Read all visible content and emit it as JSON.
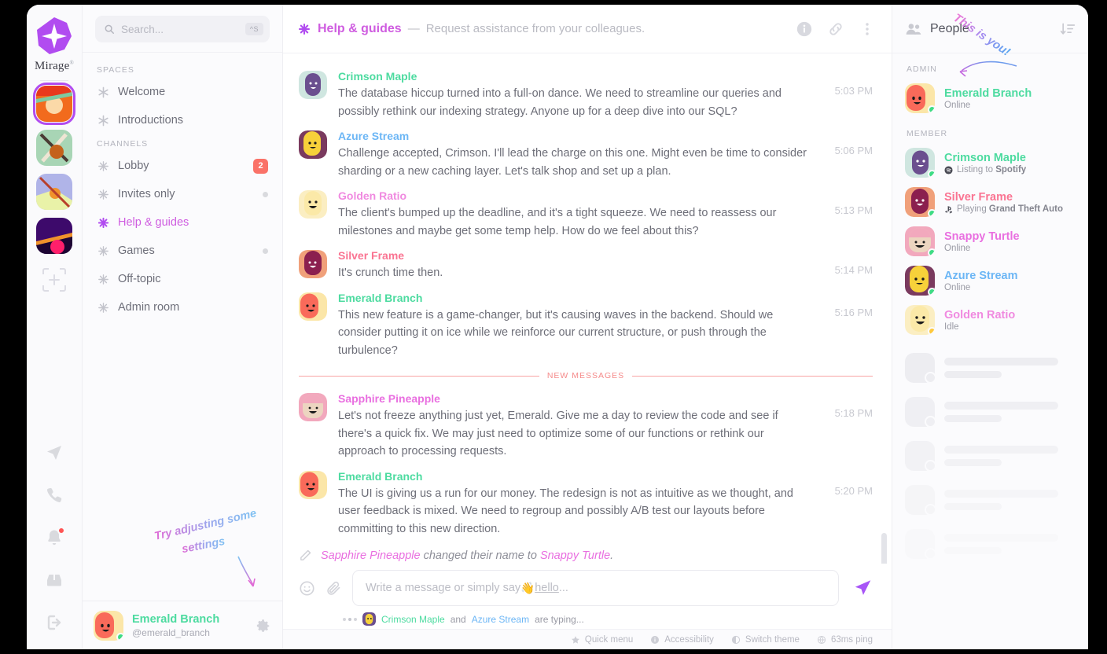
{
  "brand": {
    "name": "Mirage",
    "mark": "sparkle-logo",
    "registered": "®"
  },
  "accent": "#b14cf0",
  "rail": {
    "spaces": [
      {
        "name": "space-sushi",
        "active": true
      },
      {
        "name": "space-noodles",
        "active": false
      },
      {
        "name": "space-landscape",
        "active": false
      },
      {
        "name": "space-night",
        "active": false
      }
    ],
    "add_label": "add-space",
    "bottom_icons": [
      {
        "name": "send-icon",
        "badge": false
      },
      {
        "name": "phone-icon",
        "badge": false
      },
      {
        "name": "bell-icon",
        "badge": true
      },
      {
        "name": "inbox-icon",
        "badge": false
      },
      {
        "name": "logout-icon",
        "badge": false
      }
    ]
  },
  "search": {
    "placeholder": "Search...",
    "shortcut": "^S"
  },
  "sidebar": {
    "spaces_header": "SPACES",
    "spaces": [
      {
        "label": "Welcome",
        "icon": "asterisk-icon"
      },
      {
        "label": "Introductions",
        "icon": "asterisk-icon"
      }
    ],
    "channels_header": "CHANNELS",
    "channels": [
      {
        "label": "Lobby",
        "badge": "2",
        "dot": false,
        "active": false
      },
      {
        "label": "Invites only",
        "badge": null,
        "dot": true,
        "active": false
      },
      {
        "label": "Help & guides",
        "badge": null,
        "dot": false,
        "active": true
      },
      {
        "label": "Games",
        "badge": null,
        "dot": true,
        "active": false
      },
      {
        "label": "Off-topic",
        "badge": null,
        "dot": false,
        "active": false
      },
      {
        "label": "Admin room",
        "badge": null,
        "dot": false,
        "active": false
      }
    ],
    "annotation": {
      "line1": "Try adjusting some",
      "line2": "settings"
    }
  },
  "profile": {
    "name": "Emerald Branch",
    "handle": "@emerald_branch",
    "presence": "online",
    "settings_label": "settings-gear"
  },
  "chat_header": {
    "channel": "Help & guides",
    "dash": "—",
    "description": "Request assistance from your colleagues.",
    "actions": [
      "info-icon",
      "link-icon",
      "more-vertical-icon"
    ]
  },
  "messages": [
    {
      "author": "Crimson Maple",
      "color": "#4ddba0",
      "avatar": "purple-blob",
      "time": "5:03 PM",
      "text": "The database hiccup turned into a full-on dance. We need to streamline our queries and possibly rethink our indexing strategy. Anyone up for a deep dive into our SQL?"
    },
    {
      "author": "Azure Stream",
      "color": "#6cb6f5",
      "avatar": "yellow-blob",
      "time": "5:06 PM",
      "text": "Challenge accepted, Crimson. I'll lead the charge on this one. Might even be time to consider sharding or a new caching layer. Let's talk shop and set up a plan."
    },
    {
      "author": "Golden Ratio",
      "color": "#f08ae0",
      "avatar": "cream-blob",
      "time": "5:13 PM",
      "text": "The client's bumped up the deadline, and it's a tight squeeze. We need to reassess our milestones and maybe get some temp help. How do we feel about this?"
    },
    {
      "author": "Silver Frame",
      "color": "#fa7492",
      "avatar": "maroon-blob",
      "time": "5:14 PM",
      "text": "It's crunch time then."
    },
    {
      "author": "Emerald Branch",
      "color": "#4ddba0",
      "avatar": "red-blob",
      "time": "5:16 PM",
      "text": "This new feature is a game-changer, but it's causing waves in the backend. Should we consider putting it on ice while we reinforce our current structure, or push through the turbulence?"
    }
  ],
  "new_messages_divider": "NEW MESSAGES",
  "messages_after": [
    {
      "author": "Sapphire Pineapple",
      "color": "#e96fe0",
      "avatar": "pink-blob",
      "time": "5:18 PM",
      "text": "Let's not freeze anything just yet, Emerald. Give me a day to review the code and see if there's a quick fix. We may just need to optimize some of our functions or rethink our approach to processing requests."
    },
    {
      "author": "Emerald Branch",
      "color": "#4ddba0",
      "avatar": "red-blob",
      "time": "5:20 PM",
      "text": "The UI is giving us a run for our money. The redesign is not as intuitive as we thought, and user feedback is mixed. We need to regroup and possibly A/B test our layouts before committing to this new direction."
    }
  ],
  "system_message": {
    "icon": "pencil-icon",
    "old_name": "Sapphire Pineapple",
    "middle": " changed their name to ",
    "new_name": "Snappy Turtle",
    "end": "."
  },
  "composer": {
    "emoji_icon": "smiley-icon",
    "attach_icon": "paperclip-icon",
    "placeholder_pre": "Write a message or simply say ",
    "placeholder_emoji": "👋",
    "placeholder_link": "hello",
    "placeholder_post": "...",
    "send_icon": "send-icon",
    "typing_text_mid": " and ",
    "typing_name_1": "Crimson Maple",
    "typing_name_2": "Azure Stream",
    "typing_suffix": " are typing..."
  },
  "statusbar": [
    {
      "icon": "star-icon",
      "label": "Quick menu"
    },
    {
      "icon": "info-icon",
      "label": "Accessibility"
    },
    {
      "icon": "theme-icon",
      "label": "Switch theme"
    },
    {
      "icon": "globe-icon",
      "label": "63ms ping"
    }
  ],
  "people": {
    "title": "People",
    "sort_icon": "sort-descending-icon",
    "annotation": "This is you!",
    "admin_header": "ADMIN",
    "admins": [
      {
        "name": "Emerald Branch",
        "color": "#4ddba0",
        "avatar": "red-blob",
        "status": "Online",
        "presence": "online",
        "status_icon": null
      }
    ],
    "member_header": "MEMBER",
    "members": [
      {
        "name": "Crimson Maple",
        "color": "#4ddba0",
        "avatar": "purple-blob",
        "status": "Listing to Spotify",
        "presence": "online",
        "status_icon": "spotify-icon",
        "status_bold": "Spotify"
      },
      {
        "name": "Silver Frame",
        "color": "#fa7492",
        "avatar": "maroon-blob",
        "status": "Playing Grand Theft Auto",
        "presence": "online",
        "status_icon": "playstation-icon",
        "status_bold": "Grand Theft Auto"
      },
      {
        "name": "Snappy Turtle",
        "color": "#e96fe0",
        "avatar": "pink-blob",
        "status": "Online",
        "presence": "online",
        "status_icon": null
      },
      {
        "name": "Azure Stream",
        "color": "#6cb6f5",
        "avatar": "yellow-blob",
        "status": "Online",
        "presence": "online",
        "status_icon": null
      },
      {
        "name": "Golden Ratio",
        "color": "#f08ae0",
        "avatar": "cream-blob",
        "status": "Idle",
        "presence": "idle",
        "status_icon": null
      }
    ],
    "skeleton_count": 5
  }
}
